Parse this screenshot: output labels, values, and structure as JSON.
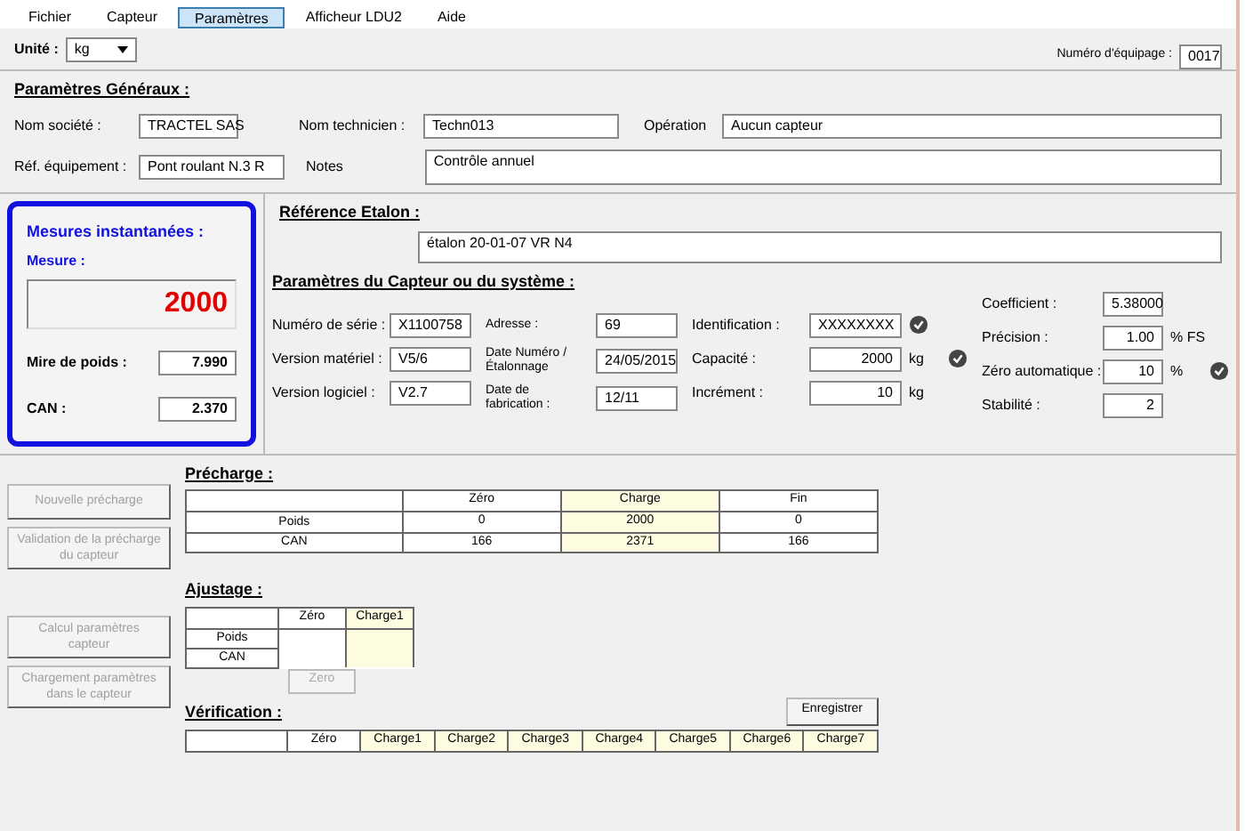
{
  "menu": [
    {
      "label": "Fichier",
      "selected": false
    },
    {
      "label": "Capteur",
      "selected": false
    },
    {
      "label": "Paramètres",
      "selected": true
    },
    {
      "label": "Afficheur LDU2",
      "selected": false
    },
    {
      "label": "Aide",
      "selected": false
    }
  ],
  "unit": {
    "label": "Unité :",
    "value": "kg"
  },
  "counter": {
    "label": "Numéro d'équipage :",
    "value": "0017"
  },
  "general": {
    "title": "Paramètres Généraux :",
    "fields": [
      {
        "label": "Nom société :",
        "value": "TRACTEL SAS"
      },
      {
        "label": "Nom technicien :",
        "value": "Techn013"
      },
      {
        "label": "Opération",
        "value": "Aucun capteur"
      },
      {
        "label": "Réf. équipement :",
        "value": "Pont roulant N.3 R"
      },
      {
        "label": "Notes",
        "value": "Contrôle annuel"
      }
    ]
  },
  "instant": {
    "title": "Mesures instantanées :",
    "measure_label": "Mesure :",
    "measure_value": "2000",
    "rows": [
      {
        "label": "Mire de poids :",
        "value": "7.990"
      },
      {
        "label": "CAN :",
        "value": "2.370"
      }
    ]
  },
  "reference": {
    "title": "Référence Etalon :",
    "value": "étalon 20-01-07 VR N4"
  },
  "sensor": {
    "title": "Paramètres du Capteur ou du système :",
    "columns": [
      [
        {
          "label": "Numéro de série :",
          "value": "X1100758"
        },
        {
          "label": "Version matériel :",
          "value": "V5/6"
        },
        {
          "label": "Version logiciel :",
          "value": "V2.7"
        }
      ],
      [
        {
          "label": "Adresse :",
          "value": "69"
        },
        {
          "label": "Date Numéro / Étalonnage",
          "value": "24/05/2015"
        },
        {
          "label": "Date de fabrication :",
          "value": "12/11"
        }
      ],
      [
        {
          "label": "Identification :",
          "value": "XXXXXXXX"
        },
        {
          "label": "Capacité :",
          "value": "2000",
          "unit": "kg"
        },
        {
          "label": "Incrément :",
          "value": "10",
          "unit": "kg"
        }
      ],
      [
        {
          "label": "Coefficient :",
          "value": "5.38000"
        },
        {
          "label": "Précision :",
          "value": "1.00",
          "unit": "% FS"
        },
        {
          "label": "Zéro automatique :",
          "value": "10",
          "unit": "%"
        },
        {
          "label": "Stabilité :",
          "value": "2"
        }
      ]
    ]
  },
  "side_buttons": [
    {
      "label": "Nouvelle précharge",
      "disabled": true
    },
    {
      "label": "Validation de la précharge du capteur",
      "disabled": true
    },
    {
      "label": "Calcul paramètres capteur",
      "disabled": true
    },
    {
      "label": "Chargement paramètres dans le capteur",
      "disabled": true
    }
  ],
  "preload": {
    "title": "Précharge :",
    "columns": [
      "Zéro",
      "Charge",
      "Fin"
    ],
    "rows": [
      {
        "label": "Poids",
        "cells": [
          "0",
          "2000",
          "0"
        ]
      },
      {
        "label": "CAN",
        "cells": [
          "166",
          "2371",
          "166"
        ]
      }
    ]
  },
  "adjust": {
    "title": "Ajustage :",
    "columns": [
      "Zéro",
      "Charge1"
    ],
    "rows": [
      {
        "label": "Poids"
      },
      {
        "label": "CAN"
      }
    ],
    "zero_button": {
      "label": "Zero",
      "disabled": true
    }
  },
  "verify": {
    "title": "Vérification :",
    "save_button": "Enregistrer",
    "columns": [
      "Zéro",
      "Charge1",
      "Charge2",
      "Charge3",
      "Charge4",
      "Charge5",
      "Charge6",
      "Charge7"
    ]
  }
}
